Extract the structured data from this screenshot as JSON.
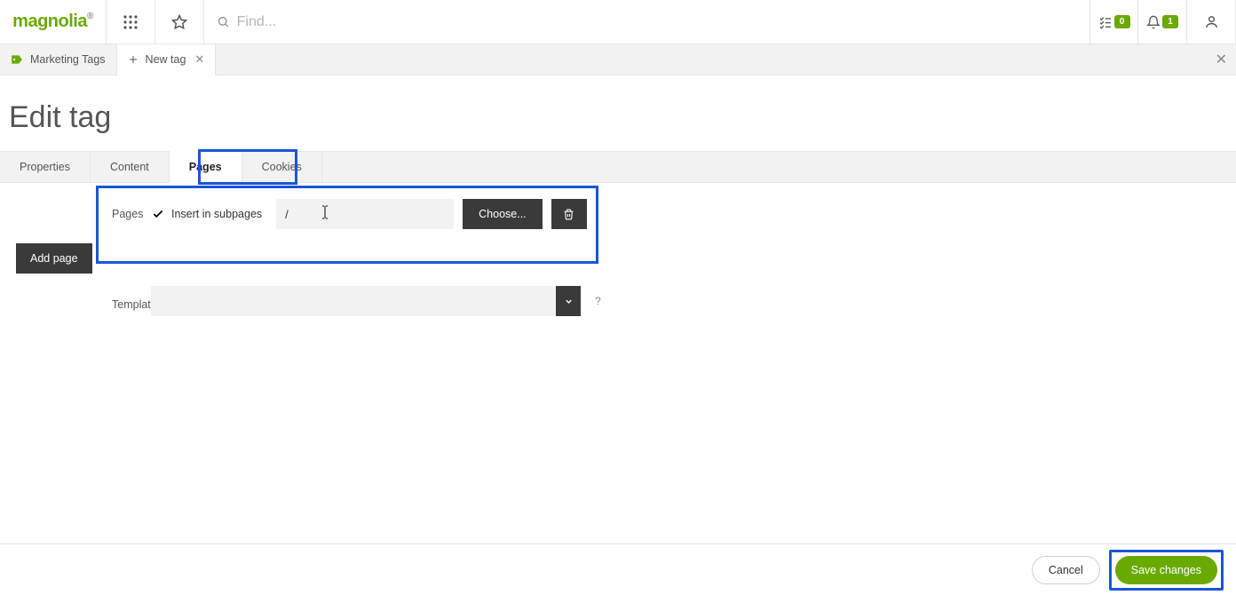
{
  "brand": "magnolia",
  "topbar": {
    "search_placeholder": "Find...",
    "tasks_badge": "0",
    "notifications_badge": "1"
  },
  "breadcrumb": {
    "root_label": "Marketing Tags",
    "current_label": "New tag"
  },
  "page": {
    "title": "Edit tag"
  },
  "form_tabs": {
    "items": [
      {
        "label": "Properties"
      },
      {
        "label": "Content"
      },
      {
        "label": "Pages"
      },
      {
        "label": "Cookies"
      }
    ],
    "active_index": 2
  },
  "form": {
    "pages_label": "Pages",
    "insert_subpages_label": "Insert in subpages",
    "insert_subpages_checked": true,
    "path_value": "/",
    "choose_label": "Choose...",
    "add_page_label": "Add page",
    "template_label": "Template",
    "template_value": "",
    "help_symbol": "?"
  },
  "footer": {
    "cancel_label": "Cancel",
    "save_label": "Save changes"
  }
}
